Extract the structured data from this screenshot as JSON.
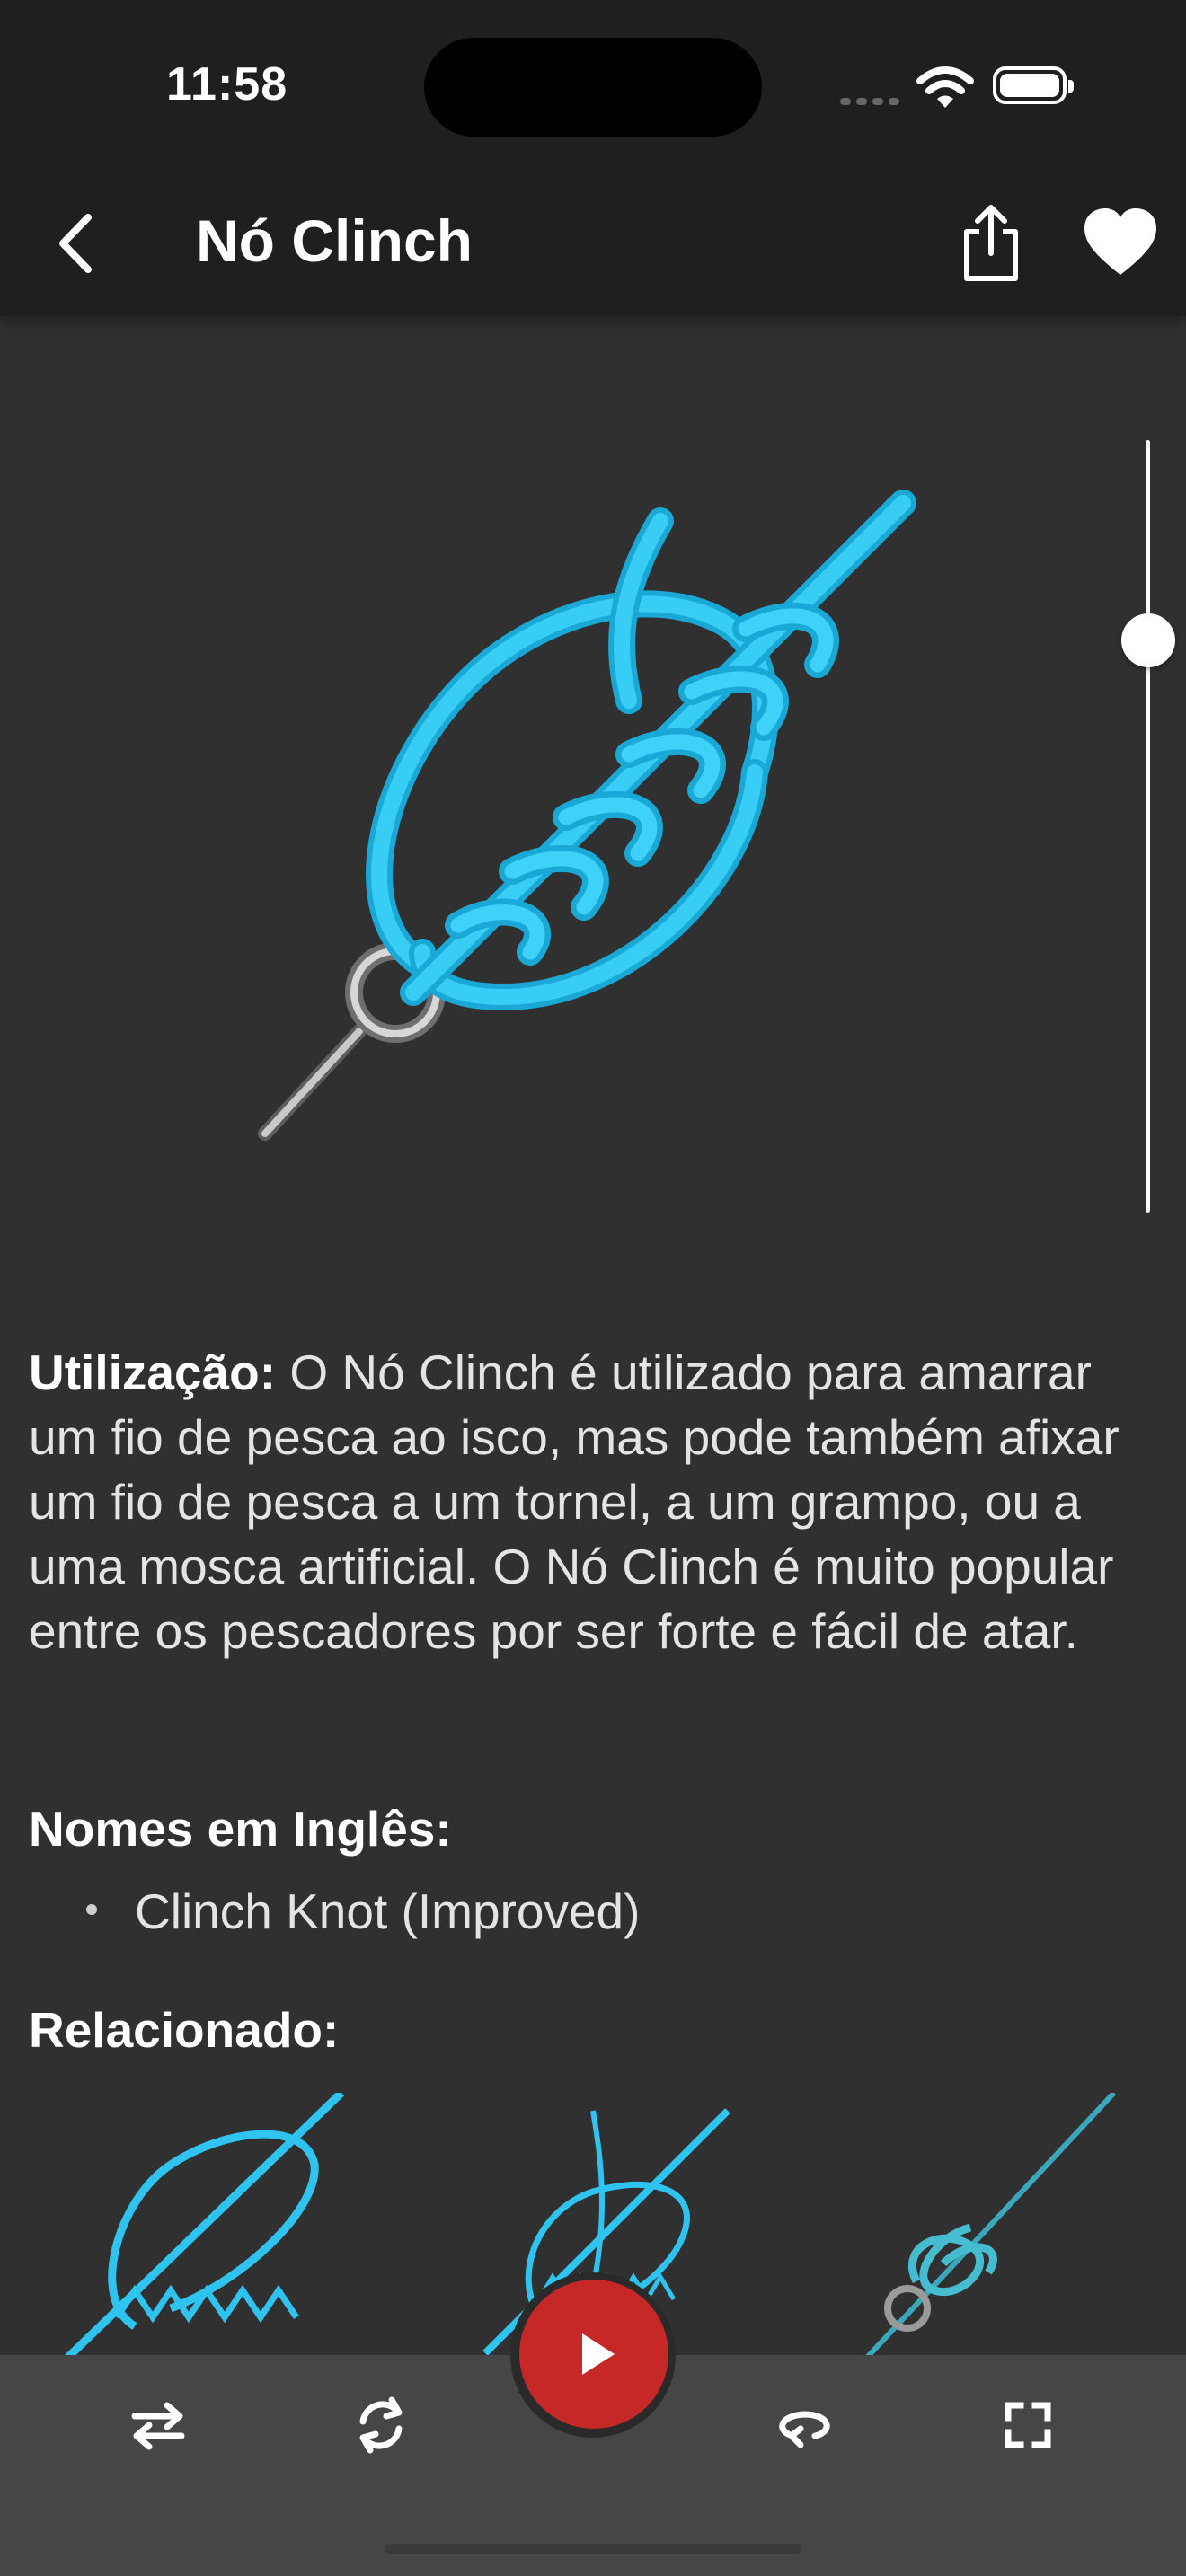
{
  "status_bar": {
    "time": "11:58"
  },
  "nav": {
    "title": "Nó Clinch"
  },
  "description": {
    "label": "Utilização:",
    "text": " O Nó Clinch é utilizado para amarrar um fio de pesca ao isco, mas pode também afixar um fio de pesca a um tornel, a um grampo, ou a uma mosca  artificial. O Nó Clinch é muito popular entre os pescadores por ser forte e fácil de atar."
  },
  "english_names": {
    "heading": "Nomes em Inglês:",
    "items": [
      "Clinch Knot (Improved)"
    ]
  },
  "related": {
    "heading": "Relacionado:"
  },
  "colors": {
    "rope": "#27c1ef",
    "play_button": "#c62828",
    "background": "#303030",
    "toolbar": "#464646"
  },
  "animation_progress_fraction": 0.21,
  "icons": [
    "back-chevron-icon",
    "share-icon",
    "heart-icon",
    "swap-icon",
    "rotate-icon",
    "play-icon",
    "loop-icon",
    "fullscreen-icon"
  ]
}
